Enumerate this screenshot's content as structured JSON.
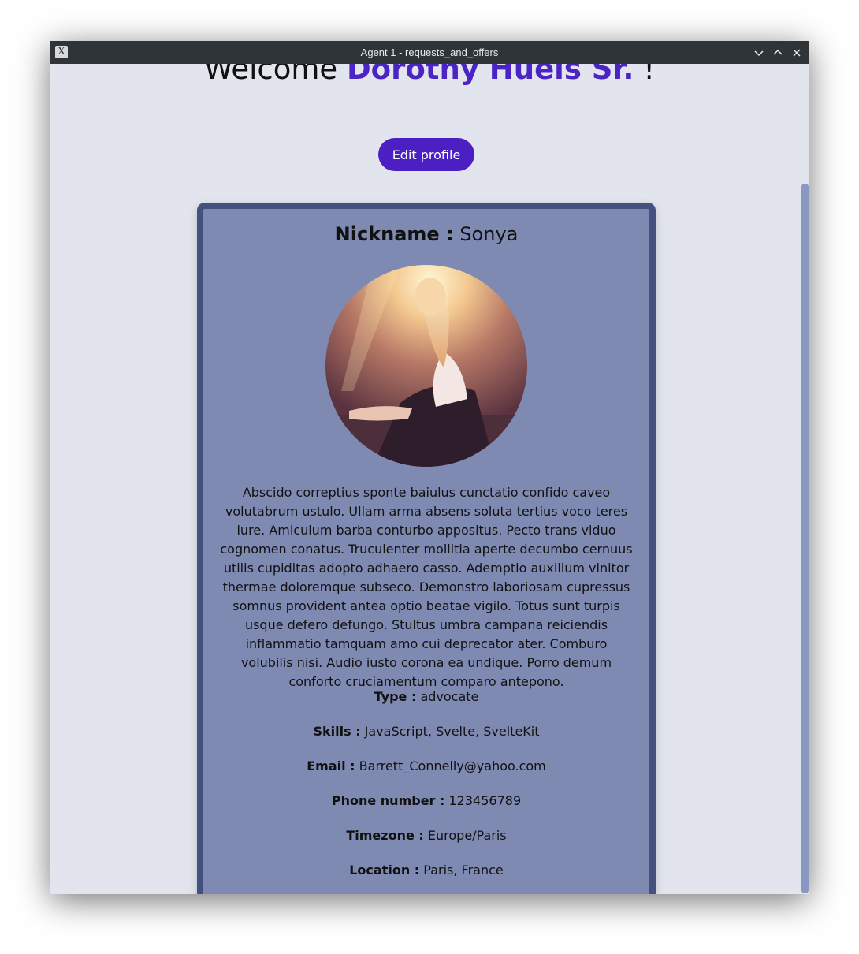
{
  "window": {
    "title": "Agent 1 - requests_and_offers",
    "controls": [
      "minimize-icon",
      "maximize-icon",
      "close-icon"
    ]
  },
  "header": {
    "welcome_prefix": "Welcome",
    "user_name": "Dorothy Huels Sr.",
    "welcome_suffix": "!"
  },
  "actions": {
    "edit_profile": "Edit profile"
  },
  "profile": {
    "nickname_label": "Nickname :",
    "nickname": "Sonya",
    "avatar": "avatar-photo",
    "bio": "Abscido correptius sponte baiulus cunctatio confido caveo volutabrum ustulo. Ullam arma absens soluta tertius voco teres iure. Amiculum barba conturbo appositus. Pecto trans viduo cognomen conatus. Truculenter mollitia aperte decumbo cernuus utilis cupiditas adopto adhaero casso. Ademptio auxilium vinitor thermae doloremque subseco. Demonstro laboriosam cupressus somnus provident antea optio beatae vigilo. Totus sunt turpis usque defero defungo. Stultus umbra campana reiciendis inflammatio tamquam amo cui deprecator ater. Comburo volubilis nisi. Audio iusto corona ea undique. Porro demum conforto cruciamentum comparo antepono.",
    "fields": [
      {
        "label": "Type :",
        "value": "advocate"
      },
      {
        "label": "Skills :",
        "value": "JavaScript, Svelte, SvelteKit"
      },
      {
        "label": "Email :",
        "value": "Barrett_Connelly@yahoo.com"
      },
      {
        "label": "Phone number :",
        "value": "123456789"
      },
      {
        "label": "Timezone :",
        "value": "Europe/Paris"
      },
      {
        "label": "Location :",
        "value": "Paris, France"
      }
    ]
  },
  "colors": {
    "accent": "#4b1fc2",
    "card_bg": "#7f8ab2",
    "card_border": "#44507e",
    "page_bg": "#e2e5ee",
    "titlebar": "#2f3438"
  }
}
